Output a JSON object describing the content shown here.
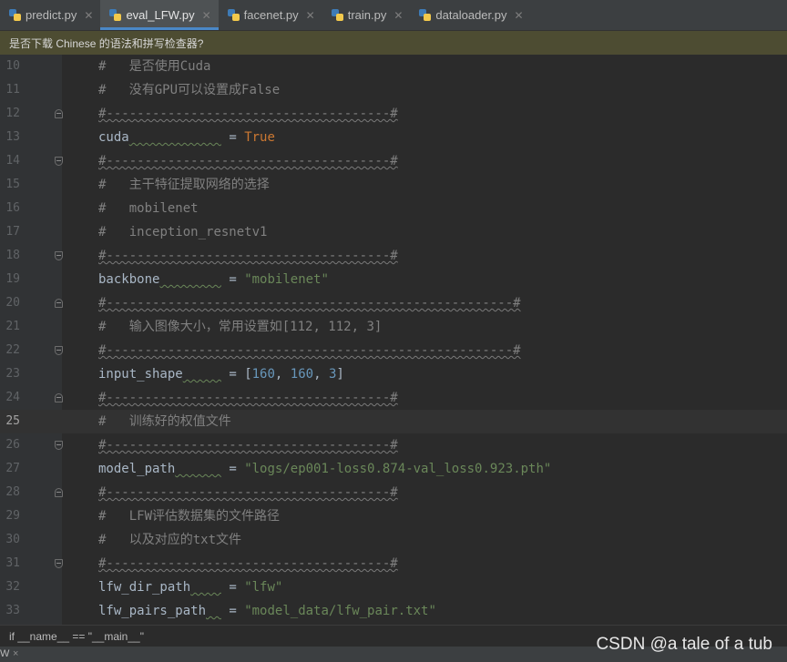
{
  "tabs": [
    {
      "label": "predict.py",
      "active": false
    },
    {
      "label": "eval_LFW.py",
      "active": true
    },
    {
      "label": "facenet.py",
      "active": false
    },
    {
      "label": "train.py",
      "active": false
    },
    {
      "label": "dataloader.py",
      "active": false
    }
  ],
  "close_glyph": "✕",
  "banner": {
    "text": "是否下载 Chinese 的语法和拼写检查器?"
  },
  "editor": {
    "current_line": "25",
    "lines": [
      {
        "n": "10",
        "hash": "#",
        "text": "是否使用Cuda"
      },
      {
        "n": "11",
        "hash": "#",
        "text": "没有GPU可以设置成False"
      },
      {
        "n": "12",
        "sep": "#-------------------------------------#"
      },
      {
        "n": "13",
        "var": "cuda",
        "val": "True"
      },
      {
        "n": "14",
        "sep": "#-------------------------------------#"
      },
      {
        "n": "15",
        "hash": "#",
        "text": "主干特征提取网络的选择"
      },
      {
        "n": "16",
        "hash": "#",
        "text": "mobilenet"
      },
      {
        "n": "17",
        "hash": "#",
        "text": "inception_resnetv1"
      },
      {
        "n": "18",
        "sep": "#-------------------------------------#"
      },
      {
        "n": "19",
        "var": "backbone",
        "val": "\"mobilenet\""
      },
      {
        "n": "20",
        "sep": "#-----------------------------------------------------#"
      },
      {
        "n": "21",
        "hash": "#",
        "text": "输入图像大小，常用设置如[112, 112, 3]"
      },
      {
        "n": "22",
        "sep": "#-----------------------------------------------------#"
      },
      {
        "n": "23",
        "var": "input_shape",
        "val_open": "[",
        "val_a": "160",
        "val_b": "160",
        "val_c": "3",
        "val_close": "]",
        "comma": ", "
      },
      {
        "n": "24",
        "sep": "#-------------------------------------#"
      },
      {
        "n": "25",
        "hash": "#",
        "text": "训练好的权值文件"
      },
      {
        "n": "26",
        "sep": "#-------------------------------------#"
      },
      {
        "n": "27",
        "var": "model_path",
        "val": "\"logs/ep001-loss0.874-val_loss0.923.pth\""
      },
      {
        "n": "28",
        "sep": "#-------------------------------------#"
      },
      {
        "n": "29",
        "hash": "#",
        "text": "LFW评估数据集的文件路径"
      },
      {
        "n": "30",
        "hash": "#",
        "text": "以及对应的txt文件"
      },
      {
        "n": "31",
        "sep": "#-------------------------------------#"
      },
      {
        "n": "32",
        "var": "lfw_dir_path",
        "val": "\"lfw\""
      },
      {
        "n": "33",
        "var": "lfw_pairs_path",
        "val": "\"model_data/lfw_pair.txt\""
      }
    ],
    "eq": "="
  },
  "breadcrumb": {
    "text": "if __name__ == \"__main__\""
  },
  "bottom": {
    "w": "W",
    "x": "×"
  },
  "watermark": "CSDN @a tale of a tub"
}
